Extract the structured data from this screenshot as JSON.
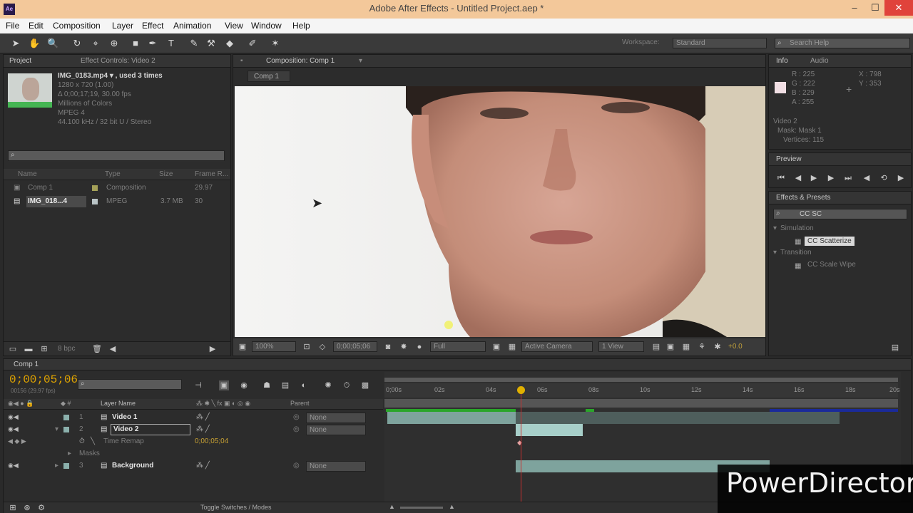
{
  "window": {
    "title": "Adobe After Effects - Untitled Project.aep *",
    "app_icon": "Ae",
    "minimize": "–",
    "maximize": "☐",
    "close": "✕"
  },
  "menu": [
    "File",
    "Edit",
    "Composition",
    "Layer",
    "Effect",
    "Animation",
    "View",
    "Window",
    "Help"
  ],
  "toolbar": {
    "workspace_label": "Workspace:",
    "workspace_value": "Standard",
    "search_placeholder": "Search Help"
  },
  "project": {
    "tab_project": "Project",
    "tab_effect_controls": "Effect Controls: Video 2",
    "footage_name": "IMG_0183.mp4 ▾ , used 3 times",
    "footage_lines": [
      "1280 x 720 (1.00)",
      "Δ 0;00;17;19, 30.00 fps",
      "Millions of Colors",
      "MPEG 4",
      "44.100 kHz / 32 bit U / Stereo"
    ],
    "columns": [
      "Name",
      "Type",
      "Size",
      "Frame R..."
    ],
    "items": [
      {
        "name": "Comp 1",
        "type": "Composition",
        "size": "",
        "rate": "29.97"
      },
      {
        "name": "IMG_018...4",
        "type": "MPEG",
        "size": "3.7 MB",
        "rate": "30"
      }
    ],
    "bpc": "8 bpc"
  },
  "composition": {
    "tab": "Composition: Comp 1",
    "sub_tab": "Comp 1",
    "zoom": "100%",
    "timecode": "0;00;05;06",
    "resolution": "Full",
    "camera": "Active Camera",
    "views": "1 View",
    "exposure": "+0.0"
  },
  "info": {
    "tab_info": "Info",
    "tab_audio": "Audio",
    "rgba": [
      "R : 225",
      "G : 222",
      "B : 229",
      "A : 255"
    ],
    "xy": [
      "X : 798",
      "Y : 353"
    ],
    "lines": [
      "Video 2",
      "Mask: Mask 1",
      "Vertices: 115"
    ]
  },
  "preview": {
    "tab": "Preview"
  },
  "effects": {
    "tab": "Effects & Presets",
    "search": "CC SC",
    "groups": [
      {
        "name": "Simulation",
        "items": [
          "CC Scatterize"
        ]
      },
      {
        "name": "Transition",
        "items": [
          "CC Scale Wipe"
        ]
      }
    ]
  },
  "timeline": {
    "tab": "Comp 1",
    "timecode": "0;00;05;06",
    "frames": "00156 (29.97 fps)",
    "columns": {
      "source": "Layer Name",
      "parent": "Parent"
    },
    "ruler": [
      "0;00s",
      "02s",
      "04s",
      "06s",
      "08s",
      "10s",
      "12s",
      "14s",
      "16s",
      "18s",
      "20s"
    ],
    "layers": [
      {
        "num": "1",
        "name": "Video 1",
        "parent": "None"
      },
      {
        "num": "2",
        "name": "Video 2",
        "parent": "None"
      },
      {
        "num": "3",
        "name": "Background",
        "parent": "None"
      }
    ],
    "time_remap": "Time Remap",
    "time_remap_value": "0;00;05;04",
    "masks": "Masks",
    "toggle": "Toggle Switches / Modes"
  },
  "watermark": "PowerDirector",
  "colors": {
    "accent_orange": "#e0a400",
    "timeline_green": "#2aa52a",
    "layer_bar": "#8ab3ab"
  }
}
